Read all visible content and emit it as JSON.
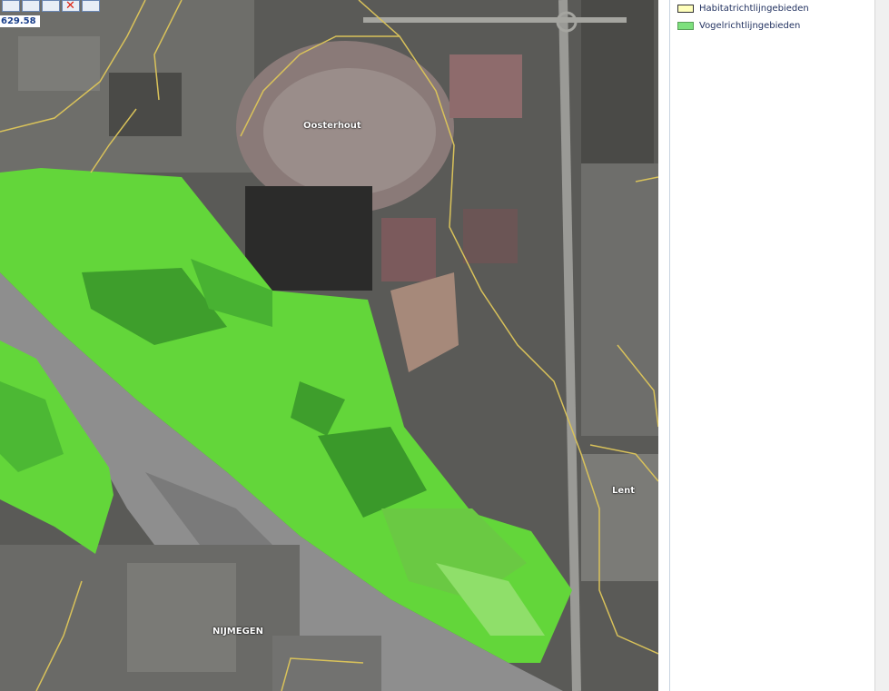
{
  "toolbar": {
    "tools": [
      {
        "icon": "zoom-extent-icon"
      },
      {
        "icon": "zoom-full-icon"
      },
      {
        "icon": "back-arrow-icon"
      },
      {
        "icon": "clear-selection-icon"
      },
      {
        "icon": "export-icon"
      }
    ]
  },
  "coordinate_readout": "629.58",
  "map": {
    "places": [
      {
        "label": "Oosterhout"
      },
      {
        "label": "Lent"
      },
      {
        "label": "NIJMEGEN"
      }
    ]
  },
  "legend": {
    "items": [
      {
        "label": "Habitatrichtlijngebieden",
        "color": "#ffffbb"
      },
      {
        "label": "Vogelrichtlijngebieden",
        "color": "#7de07d"
      }
    ]
  },
  "colors": {
    "bird_zone": "#63d63a",
    "bird_zone_dark": "#3e9e2c",
    "boundary": "#d9c25a",
    "river": "#8e8e8e"
  }
}
